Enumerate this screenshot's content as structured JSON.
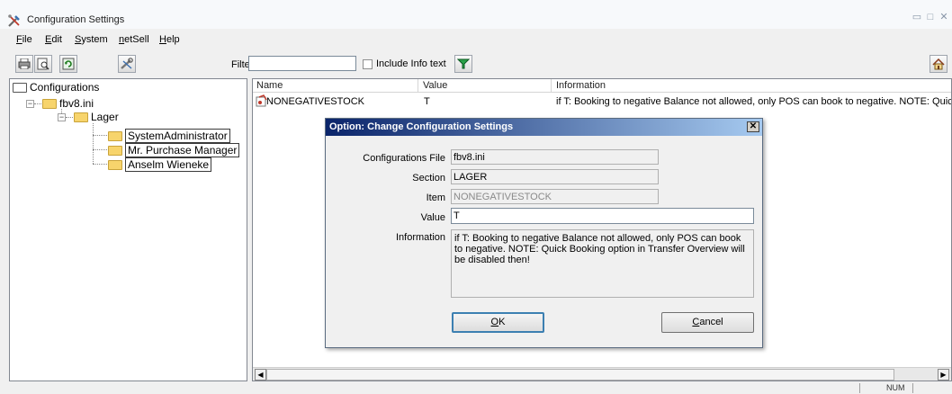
{
  "window": {
    "title": "Configuration Settings"
  },
  "menu": [
    {
      "label": "File",
      "accel": "F",
      "rest": "ile"
    },
    {
      "label": "Edit",
      "accel": "E",
      "rest": "dit"
    },
    {
      "label": "System",
      "accel": "S",
      "rest": "ystem"
    },
    {
      "label": "netSell",
      "accel": "n",
      "rest": "etSell"
    },
    {
      "label": "Help",
      "accel": "H",
      "rest": "elp"
    }
  ],
  "toolbar": {
    "filter_label": "Filter",
    "filter_value": "",
    "include_info_label": "Include Info text",
    "include_info_checked": false
  },
  "tree": {
    "root": "Configurations",
    "file": "fbv8.ini",
    "section": "Lager",
    "items": [
      "SystemAdministrator",
      "Mr. Purchase Manager",
      "Anselm Wieneke"
    ]
  },
  "list": {
    "columns": [
      "Name",
      "Value",
      "Information"
    ],
    "rows": [
      {
        "name": "NONEGATIVESTOCK",
        "value": "T",
        "info": "if T: Booking to negative Balance not allowed, only POS can book to negative. NOTE: Quick Booking option in Transfer Overview will be disabled then!"
      }
    ]
  },
  "dialog": {
    "title": "Option: Change Configuration Settings",
    "fields": {
      "configurations_file": {
        "label": "Configurations File",
        "value": "fbv8.ini"
      },
      "section": {
        "label": "Section",
        "value": "LAGER"
      },
      "item": {
        "label": "Item",
        "value": "NONEGATIVESTOCK"
      },
      "value": {
        "label": "Value",
        "value": "T"
      },
      "information": {
        "label": "Information",
        "value": "if T: Booking to negative Balance not allowed, only POS can book to negative. NOTE: Quick Booking option in Transfer Overview will be disabled then!"
      }
    },
    "ok": {
      "accel": "O",
      "rest": "K"
    },
    "cancel": {
      "accel": "C",
      "rest": "ancel"
    }
  },
  "status": {
    "num": "NUM"
  }
}
